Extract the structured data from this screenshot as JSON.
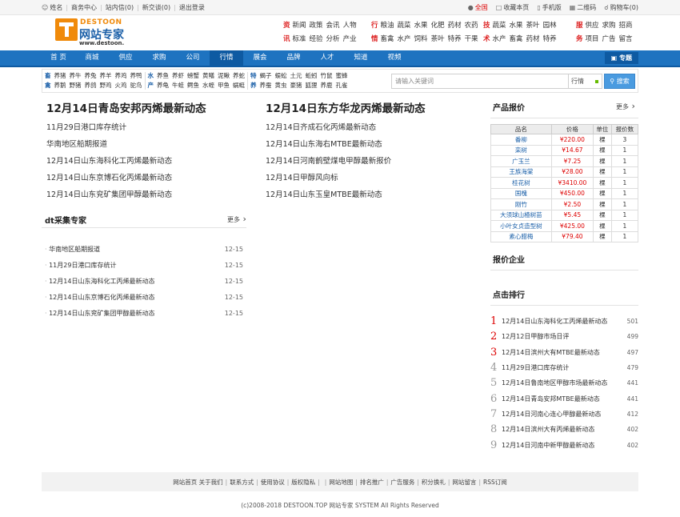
{
  "topbar": {
    "left": [
      "姓名",
      "商务中心",
      "站内信(0)",
      "新交谈(0)",
      "退出登录"
    ],
    "right": {
      "region": "全国",
      "favorite": "收藏本页",
      "mobile": "手机版",
      "qrcode": "二维码",
      "cart": "购物车(0)"
    }
  },
  "logo": {
    "en": "DESTOON",
    "cn": "网站专家",
    "url": "www.destoon."
  },
  "categories": [
    {
      "rows": [
        {
          "h": "资",
          "w": [
            "新闻",
            "政策",
            "会讯",
            "人物"
          ]
        },
        {
          "h": "讯",
          "w": [
            "标准",
            "经验",
            "分析",
            "产业"
          ]
        }
      ]
    },
    {
      "rows": [
        {
          "h": "行",
          "w": [
            "粮油",
            "蔬菜",
            "水果",
            "化肥",
            "药材",
            "农药"
          ]
        },
        {
          "h": "情",
          "w": [
            "畜禽",
            "水产",
            "饲料",
            "茶叶",
            "特养",
            "干果"
          ]
        }
      ]
    },
    {
      "rows": [
        {
          "h": "技",
          "w": [
            "蔬菜",
            "水果",
            "茶叶",
            "园林"
          ]
        },
        {
          "h": "术",
          "w": [
            "水产",
            "畜禽",
            "药材",
            "特养"
          ]
        }
      ]
    },
    {
      "rows": [
        {
          "h": "服",
          "w": [
            "供应",
            "求购",
            "招商"
          ]
        },
        {
          "h": "务",
          "w": [
            "项目",
            "广告",
            "留言"
          ]
        }
      ]
    }
  ],
  "nav": {
    "items": [
      "首 页",
      "商城",
      "供应",
      "求购",
      "公司",
      "行情",
      "展会",
      "品牌",
      "人才",
      "知道",
      "视频"
    ],
    "active": 5,
    "special": "专题"
  },
  "subnav": [
    {
      "hd": [
        "畜",
        "禽"
      ],
      "rows": [
        [
          "养猪",
          "养牛",
          "养兔",
          "养羊",
          "养鸡",
          "养鸭"
        ],
        [
          "养鹅",
          "野猪",
          "养鸽",
          "野鸡",
          "火鸡",
          "驼鸟"
        ]
      ]
    },
    {
      "hd": [
        "水",
        "产"
      ],
      "rows": [
        [
          "养鱼",
          "养虾",
          "螃蟹",
          "黄鳝",
          "泥鳅",
          "养蛇"
        ],
        [
          "养龟",
          "牛蛙",
          "鳄鱼",
          "水蛭",
          "甲鱼",
          "蜗蜓"
        ]
      ]
    },
    {
      "hd": [
        "特",
        "养"
      ],
      "rows": [
        [
          "蝎子",
          "蜈蚣",
          "土元",
          "蚯蚓",
          "竹鼠",
          "蜜蜂"
        ],
        [
          "养蚕",
          "黄虫",
          "豪猪",
          "狐狸",
          "养鹿",
          "孔雀"
        ]
      ]
    }
  ],
  "search": {
    "placeholder": "请输入关键词",
    "type": "行情",
    "button": "搜索"
  },
  "news": {
    "col1": {
      "headline": "12月14日青岛安邦丙烯最新动态",
      "items": [
        "11月29日港口库存统计",
        "华南地区船期报道",
        "12月14日山东海科化工丙烯最新动态",
        "12月14日山东京博石化丙烯最新动态",
        "12月14日山东兖矿集团甲醇最新动态"
      ]
    },
    "col2": {
      "headline": "12月14日东方华龙丙烯最新动态",
      "items": [
        "12月14日齐成石化丙烯最新动态",
        "12月14日山东海右MTBE最新动态",
        "12月14日河南鹤壁煤电甲醇最新报价",
        "12月14日甲醇风向标",
        "12月14日山东玉皇MTBE最新动态"
      ]
    }
  },
  "collector": {
    "title": "dt采集专家",
    "more": "更多",
    "items": [
      {
        "title": "华南地区船期报道",
        "date": "12-15"
      },
      {
        "title": "11月29日港口库存统计",
        "date": "12-15"
      },
      {
        "title": "12月14日山东海科化工丙烯最新动态",
        "date": "12-15"
      },
      {
        "title": "12月14日山东京博石化丙烯最新动态",
        "date": "12-15"
      },
      {
        "title": "12月14日山东兖矿集团甲醇最新动态",
        "date": "12-15"
      }
    ]
  },
  "prices": {
    "title": "产品报价",
    "more": "更多",
    "headers": [
      "品名",
      "价格",
      "单位",
      "报价数"
    ],
    "rows": [
      [
        "番柳",
        "¥220.00",
        "棵",
        "3"
      ],
      [
        "栾树",
        "¥14.67",
        "棵",
        "1"
      ],
      [
        "广玉兰",
        "¥7.25",
        "棵",
        "1"
      ],
      [
        "王族海棠",
        "¥28.00",
        "棵",
        "1"
      ],
      [
        "桂花树",
        "¥3410.00",
        "棵",
        "1"
      ],
      [
        "国槐",
        "¥450.00",
        "棵",
        "1"
      ],
      [
        "刚竹",
        "¥2.50",
        "棵",
        "1"
      ],
      [
        "大须球山楂树苗",
        "¥5.45",
        "棵",
        "1"
      ],
      [
        "小叶女贞造型树",
        "¥425.00",
        "棵",
        "1"
      ],
      [
        "素心腊梅",
        "¥79.40",
        "棵",
        "1"
      ]
    ]
  },
  "enterprise": {
    "title": "报价企业"
  },
  "ranking": {
    "title": "点击排行",
    "items": [
      {
        "num": "1",
        "title": "12月14日山东海科化工丙烯最新动态",
        "count": "501"
      },
      {
        "num": "2",
        "title": "12月12日甲醇市场日评",
        "count": "499"
      },
      {
        "num": "3",
        "title": "12月14日滨州大有MTBE最新动态",
        "count": "497"
      },
      {
        "num": "4",
        "title": "11月29日港口库存统计",
        "count": "479"
      },
      {
        "num": "5",
        "title": "12月14日鲁南地区甲醇市场最新动态",
        "count": "441"
      },
      {
        "num": "6",
        "title": "12月14日青岛安邦MTBE最新动态",
        "count": "441"
      },
      {
        "num": "7",
        "title": "12月14日河南心连心甲醇最新动态",
        "count": "412"
      },
      {
        "num": "8",
        "title": "12月14日滨州大有丙烯最新动态",
        "count": "402"
      },
      {
        "num": "9",
        "title": "12月14日河南中新甲醇最新动态",
        "count": "402"
      }
    ]
  },
  "footer": {
    "links": [
      "网站首页",
      "关于我们",
      "联系方式",
      "使用协议",
      "版权隐私",
      "网站地图",
      "排名推广",
      "广告服务",
      "积分换礼",
      "网站留言",
      "RSS订阅"
    ],
    "copyright": "(c)2008-2018 DESTOON.TOP 网站专家 SYSTEM All Rights Reserved"
  }
}
